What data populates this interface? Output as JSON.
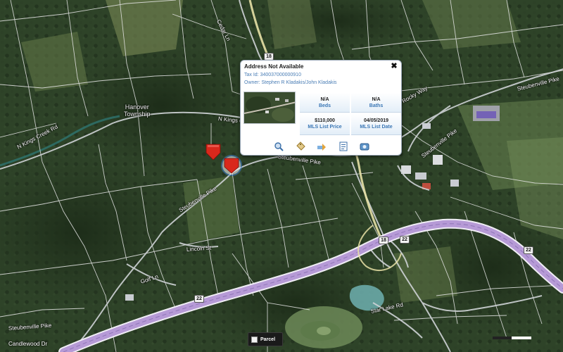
{
  "map": {
    "place_label_line1": "Hanover",
    "place_label_line2": "Township",
    "road_labels": [
      "N Kings Creek Rd",
      "Steubenville Pike",
      "Steubenville Pike",
      "N Kings Creek Rd",
      "Steubenville Pike",
      "Steubenville Pike",
      "Star Lake Rd",
      "Cedar Ln",
      "Lincoln St",
      "Golf Ln",
      "Rocky Way",
      "Steubenville Pike",
      "Candlewood Dr"
    ],
    "route_shields": [
      "18",
      "18",
      "22",
      "22",
      "22"
    ],
    "colors": {
      "parcel_lines": "#e6e6e6",
      "highway": "#b69ad6",
      "marker": "#d9281c",
      "selected_marker_ring": "#3f7fd0"
    }
  },
  "popup": {
    "title": "Address Not Available",
    "tax_id": "Tax Id: 340037000000910",
    "owner": "Owner: Stephen R Kladakis/John Kladakis",
    "close_symbol": "✖",
    "beds_value": "N/A",
    "beds_label": "Beds",
    "baths_value": "N/A",
    "baths_label": "Baths",
    "price_value": "$110,000",
    "price_label": "MLS List Price",
    "date_value": "04/05/2019",
    "date_label": "MLS List Date",
    "tools": [
      "zoom-icon",
      "tag-icon",
      "directions-icon",
      "document-icon",
      "camera-icon"
    ]
  },
  "legend": {
    "parcel_label": "Parcel"
  }
}
